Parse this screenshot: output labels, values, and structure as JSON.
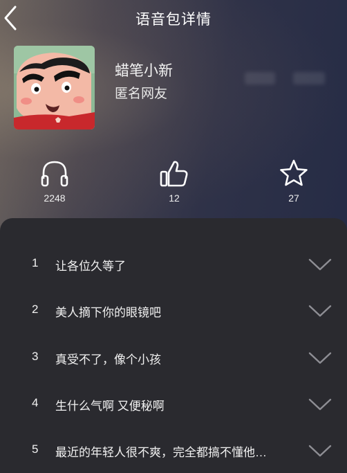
{
  "header": {
    "title": "语音包详情",
    "back_icon": "chevron-left-icon"
  },
  "profile": {
    "name": "蜡笔小新",
    "author": "匿名网友",
    "avatar_icon": "crayon-shinchan-avatar"
  },
  "stats": {
    "listens": "2248",
    "likes": "12",
    "favorites": "27",
    "icons": [
      "headphones-icon",
      "thumbs-up-icon",
      "star-icon"
    ]
  },
  "clips": [
    {
      "index": "1",
      "text": "让各位久等了"
    },
    {
      "index": "2",
      "text": "美人摘下你的眼镜吧"
    },
    {
      "index": "3",
      "text": "真受不了，像个小孩"
    },
    {
      "index": "4",
      "text": "生什么气啊 又便秘啊"
    },
    {
      "index": "5",
      "text": "最近的年轻人很不爽，完全都搞不懂他…"
    }
  ],
  "colors": {
    "panel": "#2a2a2f",
    "text": "#ffffff",
    "chevron": "#8e8e94"
  }
}
